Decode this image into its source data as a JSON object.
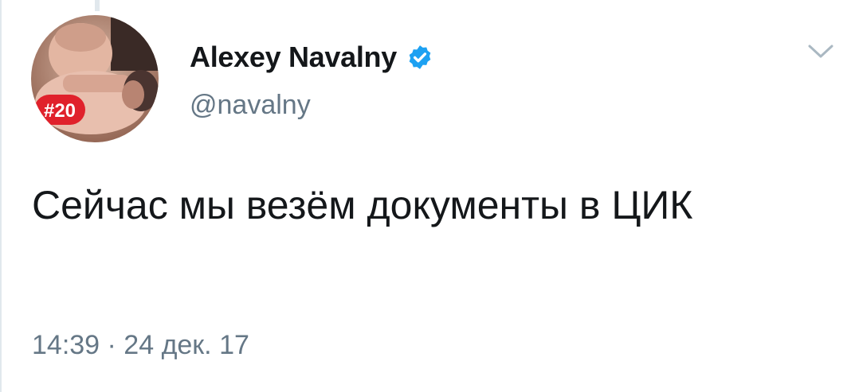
{
  "tweet": {
    "author": {
      "display_name": "Alexey Navalny",
      "handle": "@navalny",
      "verified": true,
      "avatar_badge": "#20"
    },
    "text": "Сейчас мы везём документы в ЦИК",
    "timestamp": "14:39 · 24 дек. 17"
  },
  "icons": {
    "verified": "verified-badge-icon",
    "menu": "chevron-down-icon"
  },
  "colors": {
    "verified_blue": "#1da1f2",
    "text_primary": "#14171a",
    "text_secondary": "#657786",
    "badge_red": "#e0212b"
  }
}
